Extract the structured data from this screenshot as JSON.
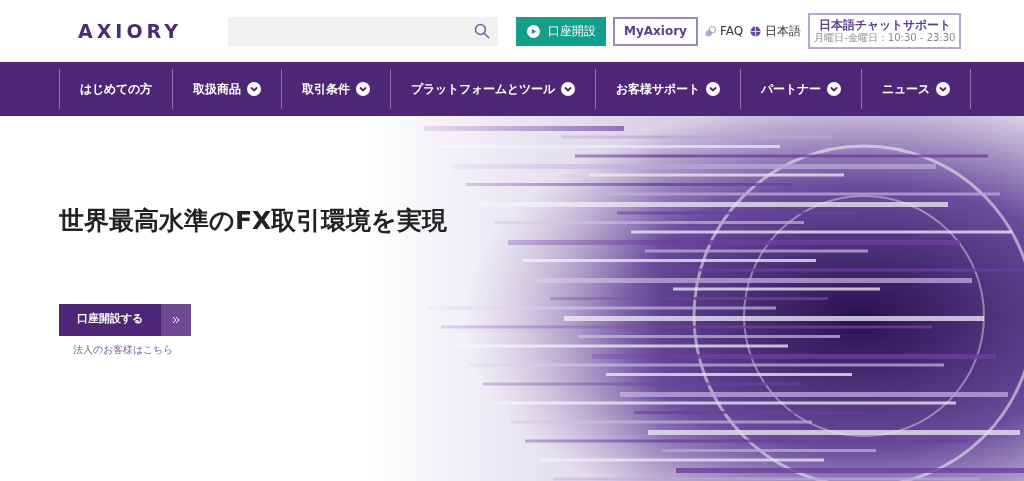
{
  "header": {
    "logo": "AXIORY",
    "open_account": "口座開設",
    "my_account": "MyAxiory",
    "faq": "FAQ",
    "language": "日本語",
    "support": {
      "title": "日本語チャットサポート",
      "hours": "月曜日-金曜日：10:30 - 23:30"
    }
  },
  "nav": [
    {
      "label": "はじめての方",
      "has_dropdown": false
    },
    {
      "label": "取扱商品",
      "has_dropdown": true
    },
    {
      "label": "取引条件",
      "has_dropdown": true
    },
    {
      "label": "プラットフォームとツール",
      "has_dropdown": true
    },
    {
      "label": "お客様サポート",
      "has_dropdown": true
    },
    {
      "label": "パートナー",
      "has_dropdown": true
    },
    {
      "label": "ニュース",
      "has_dropdown": true
    }
  ],
  "hero": {
    "headline": "世界最高水準のFX取引環境を実現",
    "cta": "口座開設する",
    "corporate_link": "法人のお客様はこちら"
  }
}
